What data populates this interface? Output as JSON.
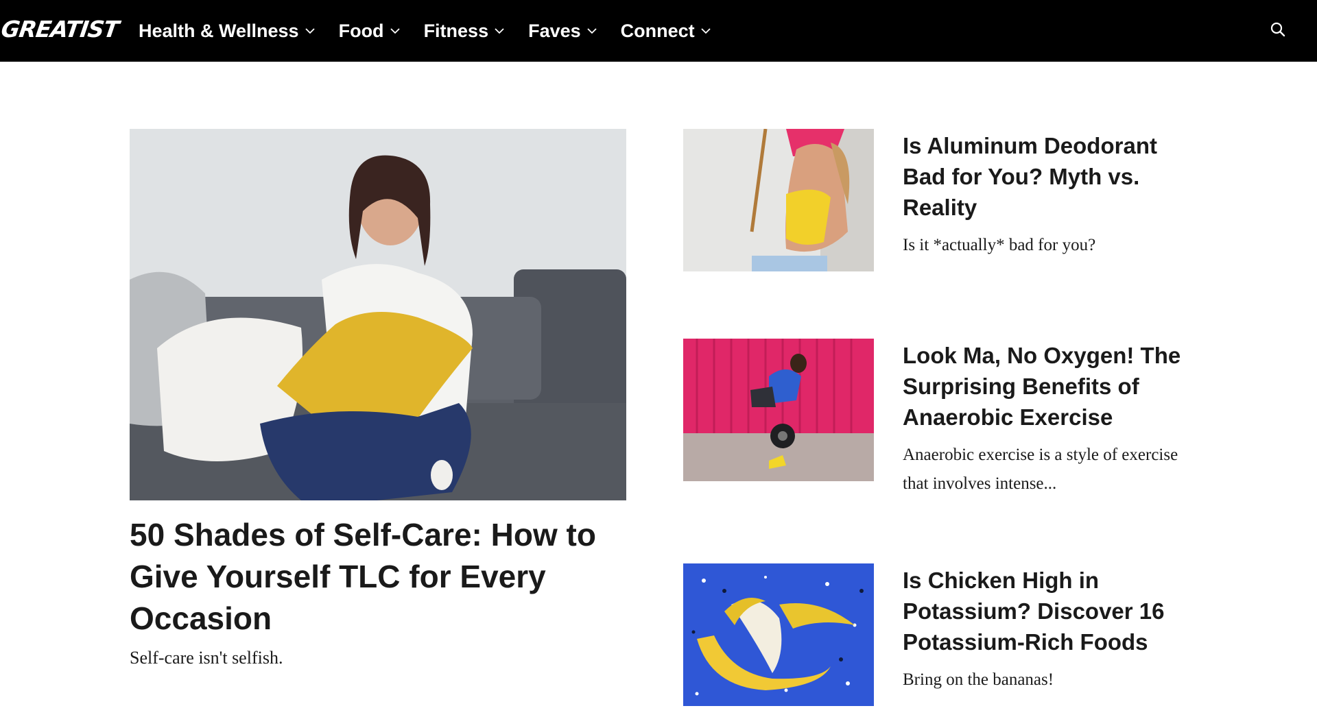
{
  "brand": {
    "logo_text": "GREATIST"
  },
  "nav": {
    "items": [
      {
        "label": "Health & Wellness"
      },
      {
        "label": "Food"
      },
      {
        "label": "Fitness"
      },
      {
        "label": "Faves"
      },
      {
        "label": "Connect"
      }
    ],
    "icons": {
      "dropdown": "chevron-down-icon",
      "search": "search-icon"
    }
  },
  "featured": {
    "title": "50 Shades of Self-Care: How to Give Yourself TLC for Every Occasion",
    "description": "Self-care isn't selfish."
  },
  "articles": [
    {
      "title": "Is Aluminum Deodorant Bad for You? Myth vs. Reality",
      "description": "Is it *actually* bad for you?"
    },
    {
      "title": "Look Ma, No Oxygen! The Surprising Benefits of Anaerobic Exercise",
      "description": "Anaerobic exercise is a style of exercise that involves intense..."
    },
    {
      "title": "Is Chicken High in Potassium? Discover 16 Potassium-Rich Foods",
      "description": "Bring on the bananas!"
    }
  ],
  "colors": {
    "nav_background": "#000000",
    "nav_text": "#ffffff",
    "page_background": "#ffffff",
    "text": "#1a1a1a"
  }
}
